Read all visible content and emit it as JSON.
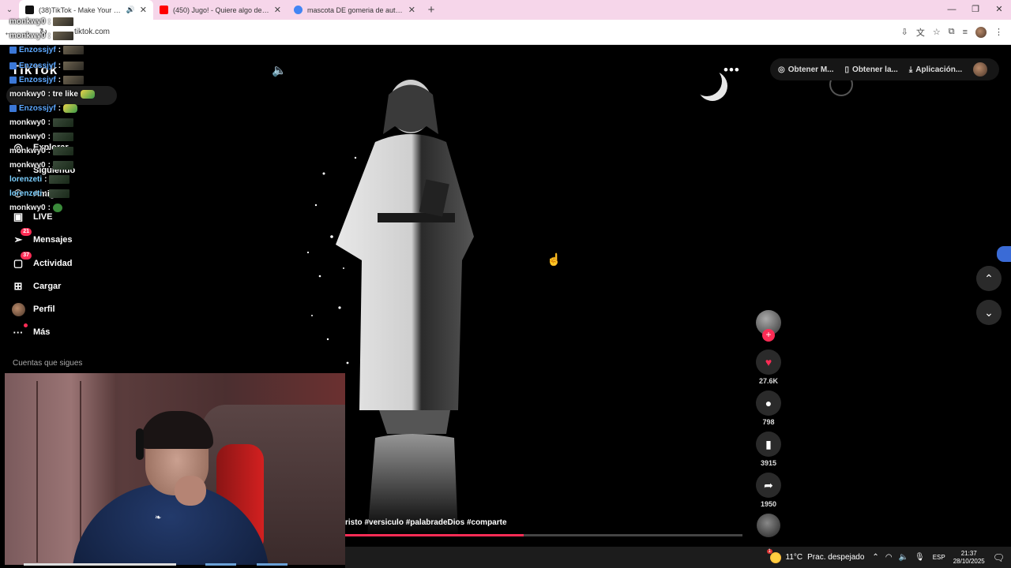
{
  "browser": {
    "tabs": [
      {
        "label": "(38)TikTok - Make Your Day",
        "favicon_color": "#111111",
        "active": true
      },
      {
        "label": "(450) Jugo! - Quiere algo de mi",
        "favicon_color": "#ff0000",
        "active": false
      },
      {
        "label": "mascota DE gomeria de autos -",
        "favicon_color": "#4285f4",
        "active": false
      }
    ],
    "url": "tiktok.com",
    "icons": [
      "tab-list-icon",
      "back-icon",
      "forward-icon",
      "reload-icon",
      "install-icon",
      "translate-icon",
      "bookmark-star-icon",
      "extensions-icon",
      "media-icon",
      "profile-icon",
      "menu-icon"
    ]
  },
  "tiktok": {
    "logo": "TikTok",
    "nav": [
      {
        "label": "Explorar",
        "icon": "compass-icon"
      },
      {
        "label": "Siguiendo",
        "icon": "following-icon"
      },
      {
        "label": "Amigos",
        "icon": "friends-icon"
      },
      {
        "label": "LIVE",
        "icon": "live-icon"
      },
      {
        "label": "Mensajes",
        "icon": "messages-icon",
        "badge": "21"
      },
      {
        "label": "Actividad",
        "icon": "activity-icon",
        "badge": "37"
      },
      {
        "label": "Cargar",
        "icon": "upload-icon"
      },
      {
        "label": "Perfil",
        "icon": "profile-avatar"
      },
      {
        "label": "Más",
        "icon": "more-icon",
        "dot": true
      }
    ],
    "following_title": "Cuentas que sigues",
    "top_actions": [
      {
        "label": "Obtener M...",
        "icon": "coin-icon"
      },
      {
        "label": "Obtener la...",
        "icon": "phone-icon"
      },
      {
        "label": "Aplicación...",
        "icon": "download-icon"
      }
    ],
    "video": {
      "caption": "risto #versiculo  #palabradeDios #comparte",
      "progress": 0.45,
      "likes": "27.6K",
      "comments": "798",
      "saves": "3915",
      "shares": "1950"
    }
  },
  "chat": [
    {
      "user": "monkwy0",
      "text": ":",
      "emote": "gif",
      "color": "normal"
    },
    {
      "user": "monkwy0",
      "text": ":",
      "emote": "gif",
      "color": "normal"
    },
    {
      "user": "Enzossjyf",
      "text": ":",
      "emote": "gif",
      "color": "blue"
    },
    {
      "user": "Enzossjyf",
      "text": ":",
      "emote": "gif",
      "color": "blue"
    },
    {
      "user": "Enzossjyf",
      "text": ":",
      "emote": "gif",
      "color": "blue"
    },
    {
      "user": "monkwy0",
      "text": ": tre like",
      "emote": "yellow",
      "color": "normal"
    },
    {
      "user": "Enzossjyf",
      "text": ":",
      "emote": "yellow",
      "color": "blue"
    },
    {
      "user": "monkwy0",
      "text": ":",
      "emote": "gif2",
      "color": "normal"
    },
    {
      "user": "monkwy0",
      "text": ":",
      "emote": "gif2",
      "color": "normal"
    },
    {
      "user": "monkwy0",
      "text": ":",
      "emote": "gif2",
      "color": "normal"
    },
    {
      "user": "monkwy0",
      "text": ":",
      "emote": "gif2",
      "color": "normal"
    },
    {
      "user": "lorenzeti",
      "text": ":",
      "emote": "gif2",
      "color": "green"
    },
    {
      "user": "lorenzeti",
      "text": ":",
      "emote": "gif2",
      "color": "green"
    },
    {
      "user": "monkwy0",
      "text": ":",
      "emote": "frog",
      "color": "normal"
    }
  ],
  "taskbar": {
    "temperature": "11°C",
    "weather": "Prac. despejado",
    "weather_badge": "1",
    "language": "ESP",
    "time": "21:37",
    "date": "28/10/2025"
  }
}
